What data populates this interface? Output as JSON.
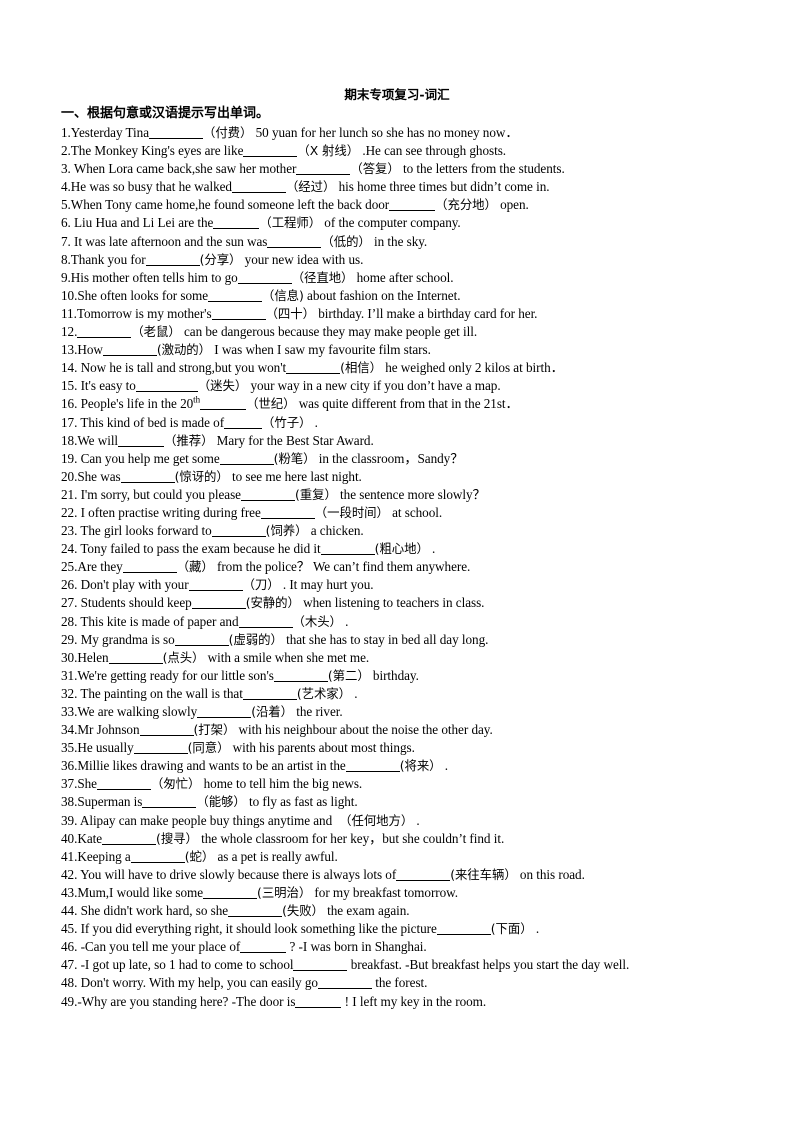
{
  "document": {
    "title": "期末专项复习-词汇",
    "section_heading": "一、根据句意或汉语提示写出单词。"
  },
  "questions": [
    {
      "num": "1.",
      "pre": "Yesterday Tina",
      "blank": "w3",
      "hint": "（付费）",
      "post": "50 yuan for her lunch so she has no money now．"
    },
    {
      "num": "2.",
      "pre": "The Monkey King's eyes are like",
      "blank": "w3",
      "hint": "（X 射线）",
      "post": ".He can see through ghosts."
    },
    {
      "num": "3. ",
      "pre": "When Lora came back,she saw her mother",
      "blank": "w3",
      "hint": "（答复）",
      "post": "to the letters from the students."
    },
    {
      "num": "4.",
      "pre": "He was so busy that he walked",
      "blank": "w3",
      "hint": "（经过）",
      "post": "his home three times but didn’t come in."
    },
    {
      "num": "5.",
      "pre": "When Tony came home,he found someone left the back door",
      "blank": "w2",
      "hint": "（充分地）",
      "post": "open."
    },
    {
      "num": "6. ",
      "pre": "Liu Hua and Li Lei are the",
      "blank": "w2",
      "hint": "（工程师）",
      "post": "of the computer company."
    },
    {
      "num": "7. ",
      "pre": "It was late afternoon and the sun was",
      "blank": "w3",
      "hint": "（低的）",
      "post": "in the sky."
    },
    {
      "num": "8.",
      "pre": "Thank you for",
      "blank": "w3",
      "hint": "(分享）",
      "post": "your new idea with us."
    },
    {
      "num": "9.",
      "pre": "His mother often tells him to go",
      "blank": "w3",
      "hint": "（径直地）",
      "post": "home after school."
    },
    {
      "num": "10.",
      "pre": "She often looks for some",
      "blank": "w3",
      "hint": "（信息)",
      "post": "about fashion on the Internet."
    },
    {
      "num": "11.",
      "pre": "Tomorrow is my mother's",
      "blank": "w3",
      "hint": "（四十）",
      "post": "birthday. I’ll make a birthday card for her."
    },
    {
      "num": "12.",
      "pre": "",
      "blank": "w3",
      "hint": "（老鼠）",
      "post": "can be dangerous because they may make people get ill."
    },
    {
      "num": "13.",
      "pre": "How",
      "blank": "w3",
      "hint": "(激动的）",
      "post": "I was when I saw my favourite film stars."
    },
    {
      "num": "14. ",
      "pre": "Now he is tall and strong,but you won't",
      "blank": "w3",
      "hint": "(相信）",
      "post": "he weighed only 2 kilos at birth．"
    },
    {
      "num": "15. ",
      "pre": "It's easy to",
      "blank": "w4",
      "hint": "（迷失）",
      "post": "your way in a new city if you don’t have a map."
    },
    {
      "num": "16. ",
      "pre": "People's life in the 20th",
      "blank": "w2",
      "hint": "（世纪）",
      "post": "was quite different from that in the 21st．",
      "sup": "th",
      "pre_sup": "People's life in the 20"
    },
    {
      "num": "17. ",
      "pre": "This kind of bed is made of",
      "blank": "w1",
      "hint": "（竹子）",
      "post": "."
    },
    {
      "num": "18.",
      "pre": "We will",
      "blank": "w2",
      "hint": "（推荐）",
      "post": "Mary for the Best Star Award."
    },
    {
      "num": "19. ",
      "pre": "Can you help me get some",
      "blank": "w3",
      "hint": "(粉笔）",
      "post": "in the classroom，Sandy？"
    },
    {
      "num": "20.",
      "pre": "She was",
      "blank": "w3",
      "hint": "(惊讶的）",
      "post": "to see me here last night."
    },
    {
      "num": "21. ",
      "pre": "I'm sorry, but could you please",
      "blank": "w3",
      "hint": "(重复）",
      "post": "the sentence more slowly？"
    },
    {
      "num": "22. ",
      "pre": "I often practise writing during free",
      "blank": "w3",
      "hint": "（一段时间）",
      "post": "at school."
    },
    {
      "num": "23. ",
      "pre": "The girl looks forward to",
      "blank": "w3",
      "hint": "(饲养）",
      "post": "a chicken."
    },
    {
      "num": "24. ",
      "pre": "Tony failed to pass the exam because he did it",
      "blank": "w3",
      "hint": "(粗心地）",
      "post": "."
    },
    {
      "num": "25.",
      "pre": "Are they",
      "blank": "w3",
      "hint": "（藏）",
      "post": "from the police？ We can’t find them anywhere."
    },
    {
      "num": "26. ",
      "pre": "Don't play with your",
      "blank": "w3",
      "hint": "（刀）",
      "post": ". It may hurt you."
    },
    {
      "num": "27. ",
      "pre": "Students should keep",
      "blank": "w3",
      "hint": "(安静的）",
      "post": "when listening to teachers in class."
    },
    {
      "num": "28. ",
      "pre": "This kite is made of paper and",
      "blank": "w3",
      "hint": "（木头）",
      "post": "."
    },
    {
      "num": "29. ",
      "pre": "My grandma is so",
      "blank": "w3",
      "hint": "(虚弱的）",
      "post": "that she has to stay in bed all day long."
    },
    {
      "num": "30.",
      "pre": "Helen",
      "blank": "w3",
      "hint": "(点头）",
      "post": "with a smile when she met me."
    },
    {
      "num": "31.",
      "pre": "We're getting ready for our little son's",
      "blank": "w3",
      "hint": "(第二）",
      "post": "birthday."
    },
    {
      "num": "32. ",
      "pre": "The painting on the wall is that",
      "blank": "w3",
      "hint": "(艺术家）",
      "post": "."
    },
    {
      "num": "33.",
      "pre": "We are walking slowly",
      "blank": "w3",
      "hint": "(沿着）",
      "post": "the river."
    },
    {
      "num": "34.",
      "pre": "Mr Johnson",
      "blank": "w3",
      "hint": "(打架）",
      "post": "with his neighbour about the noise the other day."
    },
    {
      "num": "35.",
      "pre": "He usually",
      "blank": "w3",
      "hint": "(同意）",
      "post": "with his parents about most things."
    },
    {
      "num": "36.",
      "pre": "Millie likes drawing and wants to be an artist in the",
      "blank": "w3",
      "hint": "(将来）",
      "post": "."
    },
    {
      "num": "37.",
      "pre": "She",
      "blank": "w3",
      "hint": "（匆忙）",
      "post": "home to tell him the big news."
    },
    {
      "num": "38.",
      "pre": "Superman is",
      "blank": "w3",
      "hint": "（能够）",
      "post": "to fly as fast as light."
    },
    {
      "num": "39. ",
      "pre": "Alipay can make people buy things anytime and",
      "blank": "none",
      "hint": "（任何地方）",
      "post": "."
    },
    {
      "num": "40.",
      "pre": "Kate",
      "blank": "w3",
      "hint": "(搜寻）",
      "post": "the whole classroom for her key，but she couldn’t find it."
    },
    {
      "num": "41.",
      "pre": "Keeping a",
      "blank": "w3",
      "hint": "(蛇）",
      "post": "as a pet is really awful."
    },
    {
      "num": "42. ",
      "pre": "You will have to drive slowly because there is always lots of",
      "blank": "w3",
      "hint": "(来往车辆）",
      "post": "on this road."
    },
    {
      "num": "43.",
      "pre": "Mum,I would like some",
      "blank": "w3",
      "hint": "(三明治）",
      "post": "for my breakfast tomorrow."
    },
    {
      "num": "44. ",
      "pre": "She didn't work hard, so she",
      "blank": "w3",
      "hint": "(失败）",
      "post": "the exam again."
    },
    {
      "num": "45. ",
      "pre": "If you did everything right, it should look something like the picture",
      "blank": "w3",
      "hint": "(下面）",
      "post": "."
    },
    {
      "num": "46. ",
      "pre": "-Can you tell me your place of",
      "blank": "w2",
      "hint": "",
      "post": "? -I was born in Shanghai."
    },
    {
      "num": "47. ",
      "pre": "-I got up late, so 1 had to come to school",
      "blank": "w3",
      "hint": "",
      "post": "breakfast. -But breakfast helps you start the day well."
    },
    {
      "num": "48. ",
      "pre": "Don't worry. With my help, you can easily go",
      "blank": "w3",
      "hint": "",
      "post": "the forest."
    },
    {
      "num": "49.",
      "pre": "-Why are you standing here? -The door is",
      "blank": "w2",
      "hint": "",
      "post": "! I left my key in the room."
    }
  ]
}
